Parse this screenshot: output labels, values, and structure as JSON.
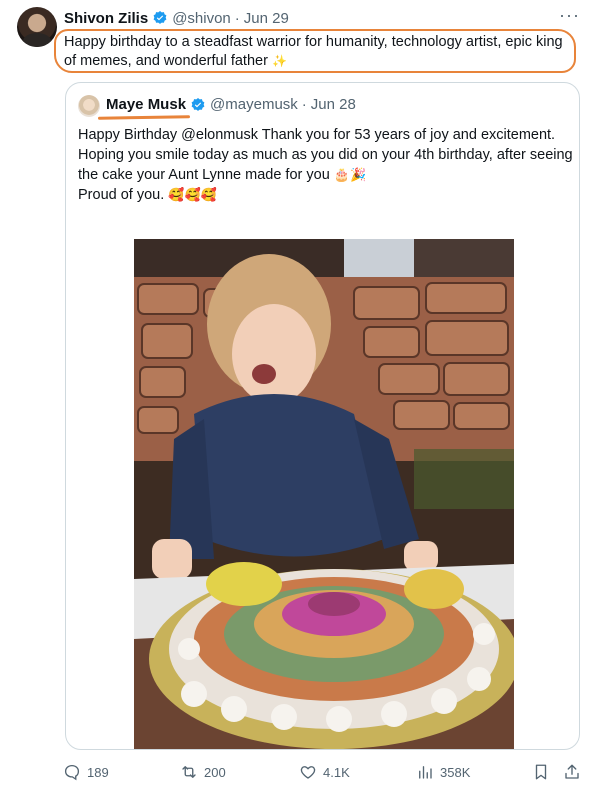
{
  "author": {
    "name": "Shivon Zilis",
    "handle": "@shivon",
    "separator": "·",
    "date": "Jun 29",
    "text": "Happy birthday to a steadfast warrior for humanity, technology artist, epic king of memes, and wonderful father"
  },
  "quoted": {
    "name": "Maye Musk",
    "handle": "@mayemusk",
    "separator": "·",
    "date": "Jun 28",
    "lines": [
      "Happy Birthday @elonmusk Thank you for 53 years of joy and excitement.",
      "Hoping you smile today as much as you did on your 4th birthday, after seeing the cake your Aunt Lynne made for you",
      "Proud of you."
    ]
  },
  "more_label": "···",
  "actions": {
    "replies": "189",
    "reposts": "200",
    "likes": "4.1K",
    "views": "358K"
  },
  "colors": {
    "verified": "#1d9bf0",
    "annotation": "#e8843a",
    "secondary_text": "#536471"
  }
}
